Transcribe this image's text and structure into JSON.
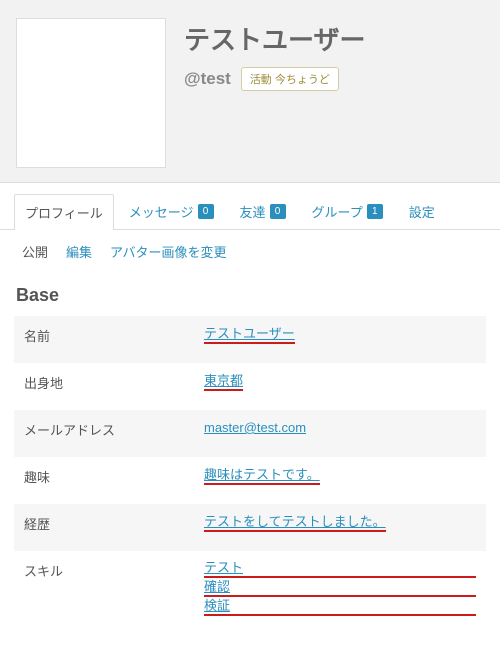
{
  "header": {
    "display_name": "テストユーザー",
    "handle": "@test",
    "activity": "活動 今ちょうど"
  },
  "tabs": {
    "profile": "プロフィール",
    "messages": "メッセージ",
    "messages_count": "0",
    "friends": "友達",
    "friends_count": "0",
    "groups": "グループ",
    "groups_count": "1",
    "settings": "設定"
  },
  "subtabs": {
    "public": "公開",
    "edit": "編集",
    "change_avatar": "アバター画像を変更"
  },
  "section_title": "Base",
  "fields": {
    "name_label": "名前",
    "name_value": "テストユーザー",
    "origin_label": "出身地",
    "origin_value": "東京都",
    "email_label": "メールアドレス",
    "email_value": "master@test.com",
    "hobby_label": "趣味",
    "hobby_value": "趣味はテストです。",
    "career_label": "経歴",
    "career_value": "テストをしてテストしました。",
    "skill_label": "スキル",
    "skill_values": {
      "0": "テスト",
      "1": "確認",
      "2": "検証"
    }
  }
}
